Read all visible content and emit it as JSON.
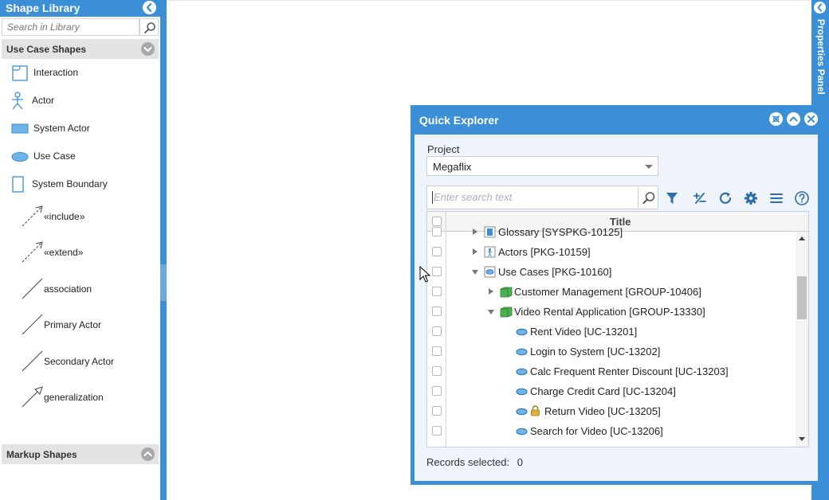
{
  "library": {
    "title": "Shape Library",
    "search_placeholder": "Search in Library",
    "sections": [
      {
        "label": "Use Case Shapes"
      },
      {
        "label": "Markup Shapes"
      }
    ],
    "shapes": [
      {
        "label": "Interaction"
      },
      {
        "label": "Actor"
      },
      {
        "label": "System Actor"
      },
      {
        "label": "Use Case"
      },
      {
        "label": "System Boundary"
      },
      {
        "label": "«include»"
      },
      {
        "label": "«extend»"
      },
      {
        "label": "association"
      },
      {
        "label": "Primary Actor"
      },
      {
        "label": "Secondary Actor"
      },
      {
        "label": "generalization"
      }
    ]
  },
  "properties_panel": {
    "title": "Properties Panel"
  },
  "quick_explorer": {
    "title": "Quick Explorer",
    "project_label": "Project",
    "project_value": "Megaflix",
    "search_placeholder": "Enter search text",
    "column_title": "Title",
    "tree": [
      {
        "label": "Glossary [SYSPKG-10125]",
        "icon": "package-icon"
      },
      {
        "label": "Actors [PKG-10159]",
        "icon": "actor-package-icon"
      },
      {
        "label": "Use Cases [PKG-10160]",
        "icon": "usecase-package-icon"
      },
      {
        "label": "Customer Management [GROUP-10406]",
        "icon": "group-icon"
      },
      {
        "label": "Video Rental Application [GROUP-13330]",
        "icon": "group-icon"
      },
      {
        "label": "Rent Video [UC-13201]",
        "icon": "usecase-icon"
      },
      {
        "label": "Login to System [UC-13202]",
        "icon": "usecase-icon"
      },
      {
        "label": "Calc Frequent Renter Discount [UC-13203]",
        "icon": "usecase-icon"
      },
      {
        "label": "Charge Credit Card [UC-13204]",
        "icon": "usecase-icon"
      },
      {
        "label": "Return Video [UC-13205]",
        "icon": "usecase-icon",
        "locked": true
      },
      {
        "label": "Search for Video [UC-13206]",
        "icon": "usecase-icon"
      }
    ],
    "records_label": "Records selected:",
    "records_count": "0"
  },
  "colors": {
    "accent": "#3b8fd6",
    "section_bar": "#e3e3e3",
    "group_icon": "#4caf50",
    "usecase_icon": "#6fb4e8"
  }
}
